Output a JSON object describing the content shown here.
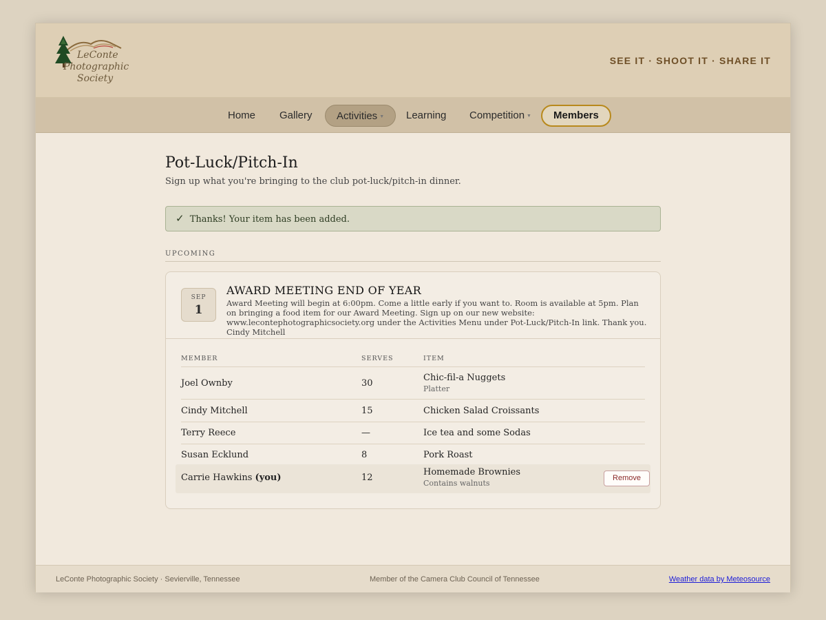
{
  "header": {
    "logo_lines": [
      "LeConte",
      "Photographic",
      "Society"
    ],
    "tagline": "SEE IT · SHOOT IT · SHARE IT"
  },
  "nav": {
    "items": [
      {
        "label": "Home"
      },
      {
        "label": "Gallery"
      },
      {
        "label": "Activities",
        "active": true,
        "has_dropdown": true
      },
      {
        "label": "Learning"
      },
      {
        "label": "Competition",
        "has_dropdown": true
      },
      {
        "label": "Members",
        "highlighted": true
      }
    ]
  },
  "page": {
    "title": "Pot-Luck/Pitch-In",
    "subtitle": "Sign up what you're bringing to the club pot-luck/pitch-in dinner.",
    "alert": "Thanks! Your item has been added.",
    "alert_icon": "✓",
    "section_label": "UPCOMING"
  },
  "event": {
    "month": "SEP",
    "day": "1",
    "title": "AWARD MEETING END OF YEAR",
    "description": "Award Meeting will begin at 6:00pm. Come a little early if you want to. Room is available at 5pm. Plan on bringing a food item for our Award Meeting. Sign up on our new website: www.lecontephotographicsociety.org under the Activities Menu under Pot-Luck/Pitch-In link. Thank you. Cindy Mitchell"
  },
  "table": {
    "headers": {
      "member": "MEMBER",
      "serves": "SERVES",
      "item": "ITEM"
    },
    "rows": [
      {
        "member": "Joel Ownby",
        "you": "",
        "serves": "30",
        "item": "Chic-fil-a Nuggets",
        "note": "Platter"
      },
      {
        "member": "Cindy Mitchell",
        "you": "",
        "serves": "15",
        "item": "Chicken Salad Croissants",
        "note": ""
      },
      {
        "member": "Terry Reece",
        "you": "",
        "serves": "—",
        "item": "Ice tea and some Sodas",
        "note": ""
      },
      {
        "member": "Susan Ecklund",
        "you": "",
        "serves": "8",
        "item": "Pork Roast",
        "note": ""
      },
      {
        "member": "Carrie Hawkins",
        "you": "(you)",
        "serves": "12",
        "item": "Homemade Brownies",
        "note": "Contains walnuts"
      }
    ],
    "remove_label": "Remove"
  },
  "footer": {
    "left": "LeConte Photographic Society · Sevierville, Tennessee",
    "center": "Member of the Camera Club Council of Tennessee",
    "right_link": "Weather data by Meteosource"
  }
}
